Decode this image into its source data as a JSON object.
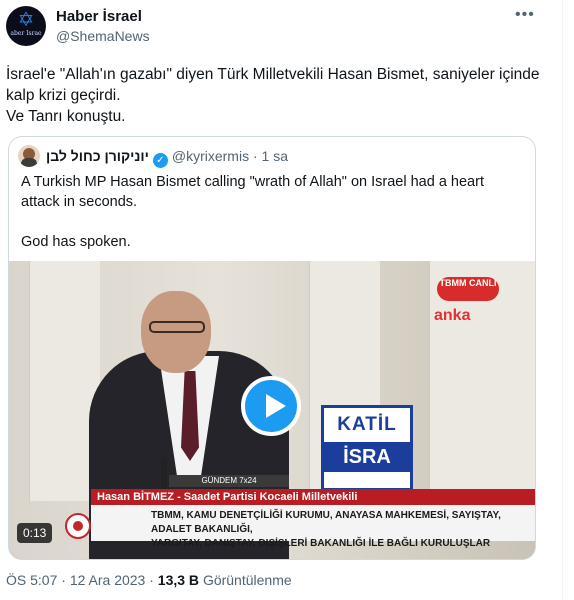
{
  "author": {
    "name": "Haber İsrael",
    "handle": "@ShemaNews",
    "avatar_text": "aber Israe"
  },
  "more_label": "•••",
  "tweet_text": "İsrael'e \"Allah'ın gazabı\" diyen Türk Milletvekili Hasan Bismet, saniyeler içinde kalp krizi geçirdi.\nVe  Tanrı konuştu.",
  "quote": {
    "name": "יוניקורן כחול לבן",
    "handle": "@kyrixermis",
    "separator": "·",
    "time": "1 sa",
    "text": "A Turkish MP Hasan Bismet calling \"wrath of Allah\" on Israel had a heart attack in seconds.\n\nGod has spoken.",
    "video": {
      "duration": "0:13",
      "channel_logo": "TBMM CANLI",
      "watermark": "anka",
      "sign_line1": "KATİL",
      "sign_line2": "İSRA",
      "top_strip": "GÜNDEM 7x24",
      "lower_third_name": "Hasan BİTMEZ - Saadet Partisi Kocaeli Milletvekili",
      "lower_third_info": "TBMM, KAMU DENETÇİLİĞİ KURUMU, ANAYASA MAHKEMESİ, SAYIŞTAY, ADALET BAKANLIĞI,\nYARGITAY, DANIŞTAY, DIŞİŞLERİ BAKANLIĞI İLE BAĞLI KURULUŞLAR"
    }
  },
  "meta": {
    "time": "ÖS 5:07",
    "sep1": "·",
    "date": "12 Ara 2023",
    "sep2": "·",
    "views": "13,3 B",
    "views_label": "Görüntülenme"
  },
  "colors": {
    "accent": "#1d9bf0",
    "text": "#0f1419",
    "muted": "#536471",
    "border": "#cfd9de"
  }
}
